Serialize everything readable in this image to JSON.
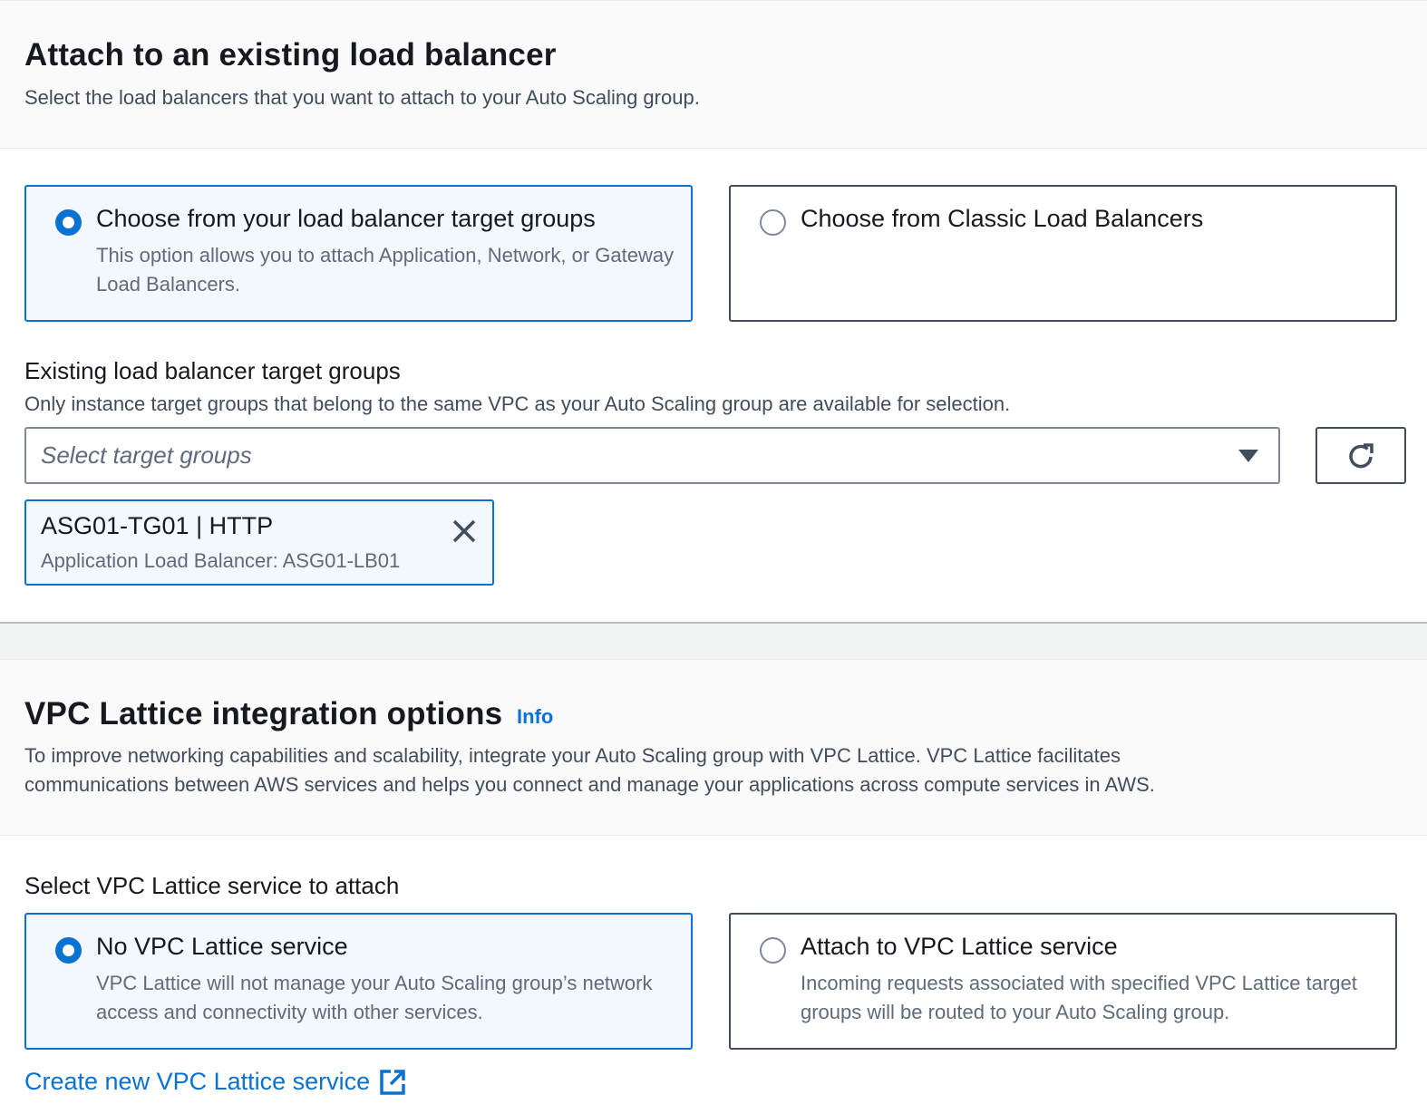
{
  "load_balancer_section": {
    "title": "Attach to an existing load balancer",
    "description": "Select the load balancers that you want to attach to your Auto Scaling group.",
    "options": [
      {
        "label": "Choose from your load balancer target groups",
        "description": "This option allows you to attach Application, Network, or Gateway Load Balancers.",
        "selected": true
      },
      {
        "label": "Choose from Classic Load Balancers",
        "description": "",
        "selected": false
      }
    ],
    "target_groups": {
      "label": "Existing load balancer target groups",
      "description": "Only instance target groups that belong to the same VPC as your Auto Scaling group are available for selection.",
      "placeholder": "Select target groups",
      "selected_tokens": [
        {
          "title": "ASG01-TG01 | HTTP",
          "subtitle": "Application Load Balancer: ASG01-LB01"
        }
      ]
    }
  },
  "vpc_lattice_section": {
    "title": "VPC Lattice integration options",
    "info_link": "Info",
    "description_line1": "To improve networking capabilities and scalability, integrate your Auto Scaling group with VPC Lattice. VPC Lattice facilitates",
    "description_line2": "communications between AWS services and helps you connect and manage your applications across compute services in AWS.",
    "field_label": "Select VPC Lattice service to attach",
    "options": [
      {
        "label": "No VPC Lattice service",
        "description": "VPC Lattice will not manage your Auto Scaling group’s network access and connectivity with other services.",
        "selected": true
      },
      {
        "label": "Attach to VPC Lattice service",
        "description": "Incoming requests associated with specified VPC Lattice target groups will be routed to your Auto Scaling group.",
        "selected": false
      }
    ],
    "create_link": "Create new VPC Lattice service"
  },
  "icons": {
    "refresh": "refresh-icon",
    "dropdown": "caret-down-icon",
    "remove": "close-icon",
    "external": "external-link-icon"
  },
  "colors": {
    "accent": "#0972d3",
    "selected_bg": "#f2f8fd",
    "text": "#16191f",
    "secondary_text": "#5f6b7a"
  }
}
